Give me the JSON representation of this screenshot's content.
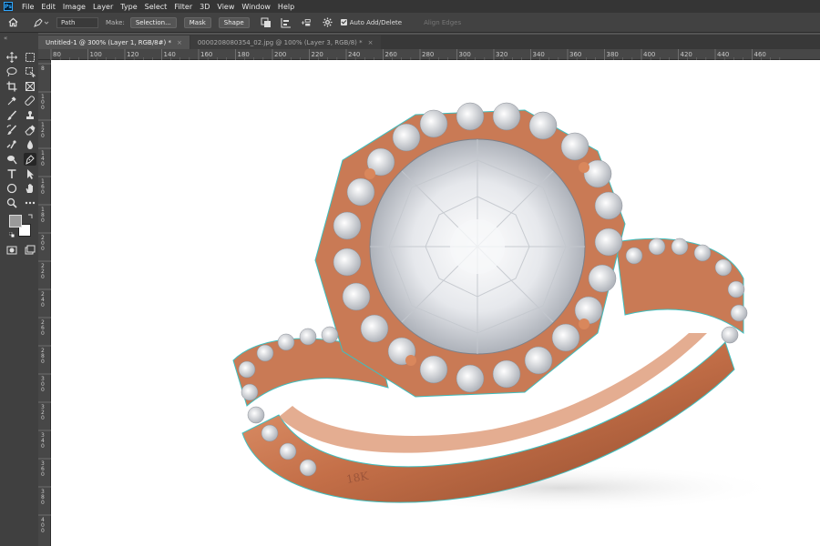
{
  "app": {
    "logo": "Ps"
  },
  "menu": [
    "File",
    "Edit",
    "Image",
    "Layer",
    "Type",
    "Select",
    "Filter",
    "3D",
    "View",
    "Window",
    "Help"
  ],
  "options": {
    "mode": "Path",
    "make_label": "Make:",
    "selection_btn": "Selection...",
    "mask_btn": "Mask",
    "shape_btn": "Shape",
    "auto_add_delete": "Auto Add/Delete",
    "align_edges": "Align Edges"
  },
  "tabs": [
    {
      "title": "Untitled-1 @ 300% (Layer 1, RGB/8#) *",
      "close": "×"
    },
    {
      "title": "0000208080354_02.jpg @ 100% (Layer 3, RGB/8) *",
      "close": "×"
    }
  ],
  "ruler": {
    "h_ticks": [
      "80",
      "100",
      "120",
      "140",
      "160",
      "180",
      "200",
      "220",
      "240",
      "260",
      "280",
      "300",
      "320",
      "340",
      "360",
      "380",
      "400",
      "420",
      "440",
      "460"
    ],
    "v_ticks": [
      "8",
      "1\n0\n0",
      "1\n2\n0",
      "1\n4\n0",
      "1\n6\n0",
      "1\n8\n0",
      "2\n0\n0",
      "2\n2\n0",
      "2\n4\n0",
      "2\n6\n0",
      "2\n8\n0",
      "3\n0\n0",
      "3\n2\n0",
      "3\n4\n0",
      "3\n6\n0",
      "3\n8\n0",
      "4\n0\n0"
    ]
  },
  "toolbar": {
    "collapse": "«"
  },
  "engraving": "18K",
  "colors": {
    "foreground": "#9a9a9a",
    "background": "#ffffff",
    "path_outline": "#3fbfbf",
    "metal": "#c9754f"
  }
}
